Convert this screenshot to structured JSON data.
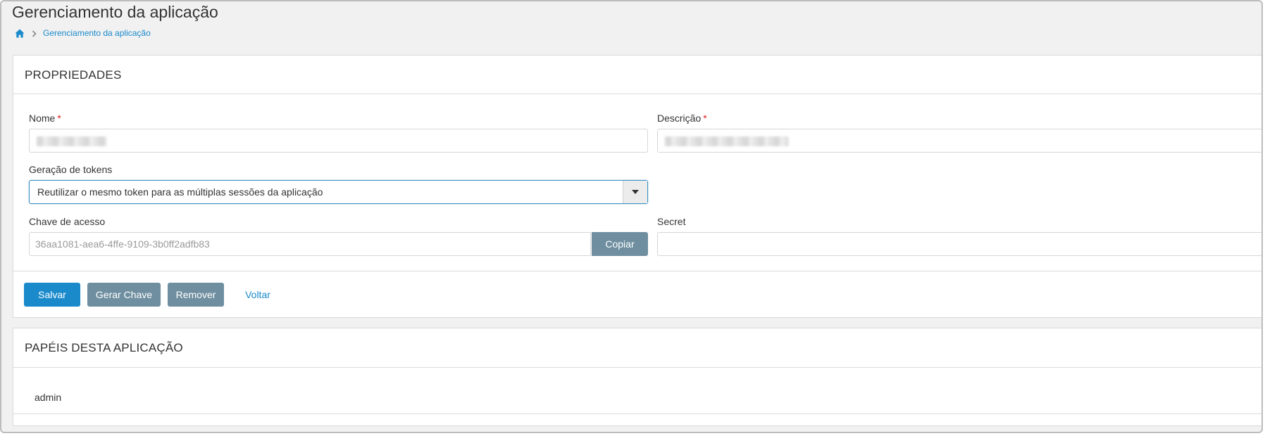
{
  "page": {
    "title": "Gerenciamento da aplicação",
    "breadcrumb": [
      "Gerenciamento da aplicação"
    ]
  },
  "properties": {
    "heading": "PROPRIEDADES",
    "name_label": "Nome",
    "description_label": "Descrição",
    "required_mark": "*",
    "token_generation_label": "Geração de tokens",
    "token_generation_value": "Reutilizar o mesmo token para as múltiplas sessões da aplicação",
    "access_key_label": "Chave de acesso",
    "access_key_value": "36aa1081-aea6-4ffe-9109-3b0ff2adfb83",
    "copy_label": "Copiar",
    "secret_label": "Secret",
    "secret_value": ""
  },
  "actions": {
    "save": "Salvar",
    "generate_key": "Gerar Chave",
    "remove": "Remover",
    "back": "Voltar"
  },
  "roles": {
    "heading": "PAPÉIS DESTA APLICAÇÃO",
    "items": [
      "admin"
    ]
  },
  "colors": {
    "primary": "#1a8acb",
    "secondary": "#6f8fa0",
    "required": "#e02020"
  }
}
